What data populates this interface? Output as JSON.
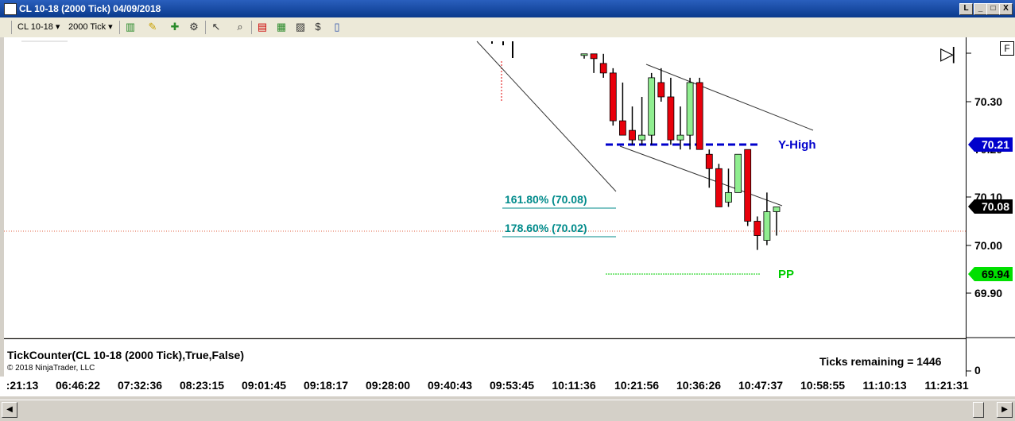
{
  "window": {
    "title": "CL 10-18 (2000 Tick)  04/09/2018",
    "buttons": {
      "restore_small": "L",
      "minimize": "_",
      "maximize": "□",
      "close": "X"
    }
  },
  "toolbar": {
    "instrument": "CL 10-18",
    "interval": "2000 Tick",
    "icons": [
      "bar-type-icon",
      "drawing-pencil-icon",
      "add-indicator-icon",
      "strategy-icon",
      "cursor-icon",
      "zoom-icon",
      "chart-style-icon",
      "data-box-icon",
      "chart-trader-icon",
      "properties-icon",
      "pages-icon"
    ]
  },
  "chart": {
    "fib_161": "161.80% (70.08)",
    "fib_178": "178.60% (70.02)",
    "y_high_label": "Y-High",
    "pp_label": "PP",
    "play_icon": "▷|",
    "price_min": 69.84,
    "price_max": 70.4,
    "colors": {
      "up": "#90ee90",
      "down": "#e8000b",
      "y_high": "#0000cc",
      "pp": "#00cc00",
      "fib": "#008b8b"
    },
    "candles": [
      {
        "o": 70.4,
        "h": 70.4,
        "l": 70.39,
        "c": 70.4
      },
      {
        "o": 70.4,
        "h": 70.4,
        "l": 70.36,
        "c": 70.39
      },
      {
        "o": 70.38,
        "h": 70.4,
        "l": 70.35,
        "c": 70.36
      },
      {
        "o": 70.36,
        "h": 70.37,
        "l": 70.25,
        "c": 70.26
      },
      {
        "o": 70.26,
        "h": 70.34,
        "l": 70.23,
        "c": 70.23
      },
      {
        "o": 70.24,
        "h": 70.29,
        "l": 70.21,
        "c": 70.22
      },
      {
        "o": 70.22,
        "h": 70.31,
        "l": 70.21,
        "c": 70.23
      },
      {
        "o": 70.23,
        "h": 70.36,
        "l": 70.21,
        "c": 70.35
      },
      {
        "o": 70.34,
        "h": 70.37,
        "l": 70.3,
        "c": 70.31
      },
      {
        "o": 70.31,
        "h": 70.35,
        "l": 70.21,
        "c": 70.22
      },
      {
        "o": 70.22,
        "h": 70.29,
        "l": 70.2,
        "c": 70.23
      },
      {
        "o": 70.23,
        "h": 70.35,
        "l": 70.2,
        "c": 70.34
      },
      {
        "o": 70.34,
        "h": 70.35,
        "l": 70.2,
        "c": 70.2
      },
      {
        "o": 70.19,
        "h": 70.2,
        "l": 70.12,
        "c": 70.16
      },
      {
        "o": 70.16,
        "h": 70.17,
        "l": 70.08,
        "c": 70.08
      },
      {
        "o": 70.09,
        "h": 70.16,
        "l": 70.08,
        "c": 70.11
      },
      {
        "o": 70.11,
        "h": 70.19,
        "l": 70.11,
        "c": 70.19
      },
      {
        "o": 70.2,
        "h": 70.2,
        "l": 70.04,
        "c": 70.05
      },
      {
        "o": 70.05,
        "h": 70.06,
        "l": 69.99,
        "c": 70.02
      },
      {
        "o": 70.01,
        "h": 70.11,
        "l": 70.0,
        "c": 70.07
      },
      {
        "o": 70.07,
        "h": 70.08,
        "l": 70.02,
        "c": 70.08
      }
    ]
  },
  "price_axis": {
    "labels": [
      "70.30",
      "70.20",
      "70.10",
      "70.00",
      "69.90"
    ],
    "current_price": "70.08",
    "y_high_price": "70.21",
    "pp_price": "69.94",
    "top_button": "F"
  },
  "indicator": {
    "name": "TickCounter(CL 10-18 (2000 Tick),True,False)",
    "copyright": "© 2018 NinjaTrader, LLC",
    "ticks_remaining": "Ticks remaining = 1446",
    "axis_zero": "0"
  },
  "time_axis": {
    "labels": [
      ":21:13",
      "06:46:22",
      "07:32:36",
      "08:23:15",
      "09:01:45",
      "09:18:17",
      "09:28:00",
      "09:40:43",
      "09:53:45",
      "10:11:36",
      "10:21:56",
      "10:36:26",
      "10:47:37",
      "10:58:55",
      "11:10:13",
      "11:21:31"
    ]
  }
}
